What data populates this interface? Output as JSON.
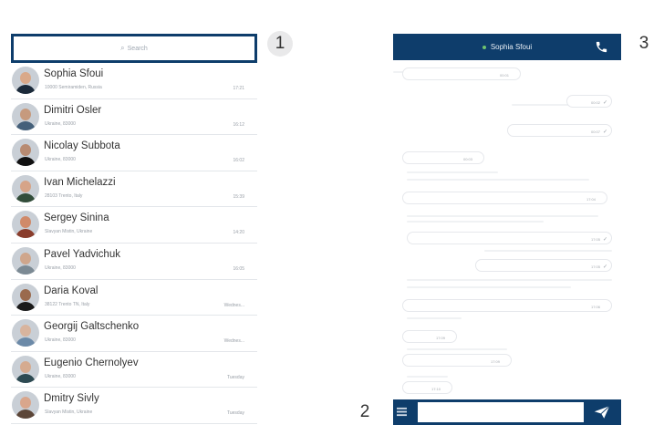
{
  "search": {
    "placeholder": "Search",
    "icon": "search-icon"
  },
  "annotations": [
    "1",
    "2",
    "3"
  ],
  "contacts": [
    {
      "name": "Sophia Sfoui",
      "sub": "10000 Semiramiden, Russia",
      "time": "17:21",
      "skin": "#d9a98a",
      "shirt": "#1b2a3a"
    },
    {
      "name": "Dimitri Osler",
      "sub": "Ukraine, 83000",
      "time": "16:12",
      "skin": "#c69a7e",
      "shirt": "#45607a"
    },
    {
      "name": "Nicolay Subbota",
      "sub": "Ukraine, 83000",
      "time": "16:02",
      "skin": "#b88b72",
      "shirt": "#111111"
    },
    {
      "name": "Ivan Michelazzi",
      "sub": "28103 Trento, Italy",
      "time": "15:39",
      "skin": "#d6a488",
      "shirt": "#324d3a"
    },
    {
      "name": "Sergey Sinina",
      "sub": "Slavyan Mistin, Ukraine",
      "time": "14:20",
      "skin": "#d08a6a",
      "shirt": "#8a3d2c"
    },
    {
      "name": "Pavel Yadvichuk",
      "sub": "Ukraine, 83000",
      "time": "16:05",
      "skin": "#cfa68c",
      "shirt": "#7c8a94"
    },
    {
      "name": "Daria Koval",
      "sub": "38122 Trento TN, Italy",
      "time": "Wednes...",
      "skin": "#9a6a4e",
      "shirt": "#1a1a1a"
    },
    {
      "name": "Georgij Galtschenko",
      "sub": "Ukraine, 83000",
      "time": "Wednes...",
      "skin": "#d8b49e",
      "shirt": "#6c8aa8"
    },
    {
      "name": "Eugenio Chernolyev",
      "sub": "Ukraine, 83000",
      "time": "Tuesday",
      "skin": "#d5ab90",
      "shirt": "#2d4a52"
    },
    {
      "name": "Dmitry Sivly",
      "sub": "Slavyan Mistin, Ukraine",
      "time": "Tuesday",
      "skin": "#d9a68c",
      "shirt": "#5c4638"
    }
  ],
  "chat": {
    "contact_name": "Sophia Sfoui",
    "status_color": "#6fc36f",
    "header_color": "#0e3d6b",
    "messages": [
      {
        "side": "in",
        "time": "00:01"
      },
      {
        "side": "out",
        "time": "00:02"
      },
      {
        "side": "out",
        "time": "00:07"
      },
      {
        "side": "in",
        "time": "00:03"
      },
      {
        "side": "in",
        "time": "17:04"
      },
      {
        "side": "out",
        "time": "17:05"
      },
      {
        "side": "out",
        "time": "17:05"
      },
      {
        "side": "in",
        "time": "17:06"
      },
      {
        "side": "in",
        "time": "17:09"
      },
      {
        "side": "in",
        "time": "17:09"
      },
      {
        "side": "in",
        "time": "17:10"
      }
    ]
  },
  "composer": {
    "placeholder": "",
    "menu_icon": "menu-icon",
    "send_icon": "send-icon"
  }
}
